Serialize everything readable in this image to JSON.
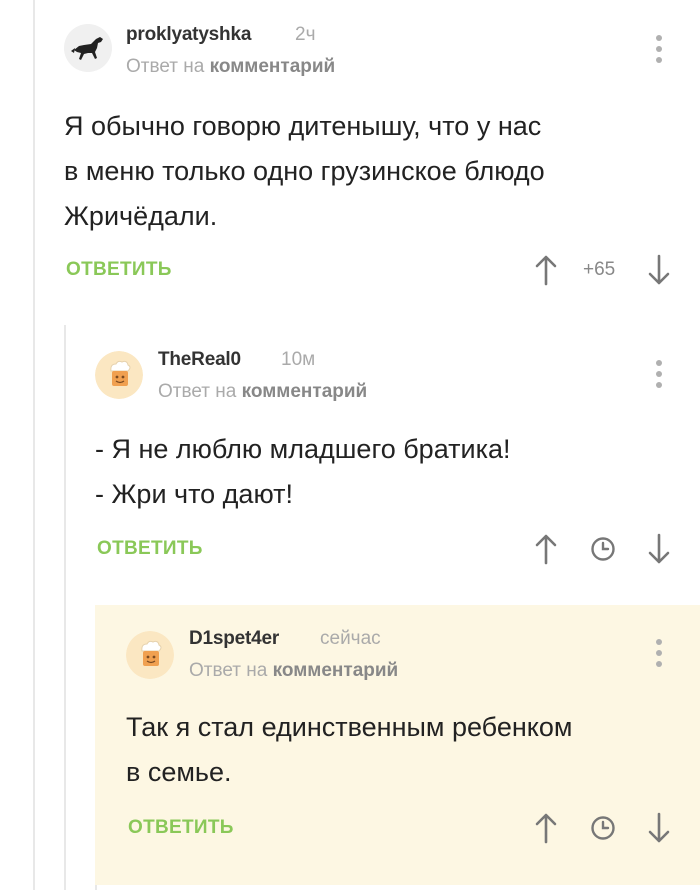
{
  "comments": [
    {
      "author": "proklyatyshka",
      "time": "2ч",
      "reply_prefix": "Ответ на",
      "reply_target": "комментарий",
      "lines": [
        "Я обычно говорю дитенышу, что у нас",
        "в меню только одно грузинское блюдо",
        "Жричёдали."
      ],
      "reply_label": "ОТВЕТИТЬ",
      "score": "+65"
    },
    {
      "author": "TheReal0",
      "time": "10м",
      "reply_prefix": "Ответ на",
      "reply_target": "комментарий",
      "lines": [
        "- Я не люблю младшего братика!",
        "- Жри что дают!"
      ],
      "reply_label": "ОТВЕТИТЬ"
    },
    {
      "author": "D1spet4er",
      "time": "сейчас",
      "reply_prefix": "Ответ на",
      "reply_target": "комментарий",
      "lines": [
        "Так я стал единственным ребенком",
        "в семье."
      ],
      "reply_label": "ОТВЕТИТЬ"
    }
  ],
  "icons": {
    "upvote": "arrow-up-icon",
    "downvote": "arrow-down-icon",
    "pending": "clock-icon",
    "menu": "more-vertical-icon"
  },
  "colors": {
    "accent_green": "#8ac858",
    "highlight_bg": "#fdf7e3",
    "muted_text": "#aaaaaa"
  }
}
